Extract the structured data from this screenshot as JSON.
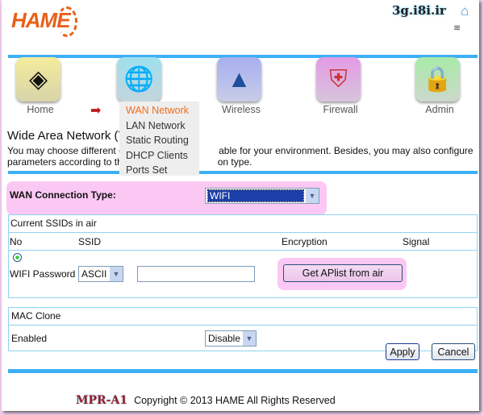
{
  "header": {
    "logo": "HAME",
    "site": "3g.i8i.ir",
    "home_icon": "home-icon",
    "signal_icon": "wifi-icon"
  },
  "nav": [
    {
      "label": "Home",
      "icon": "home-diamond-icon"
    },
    {
      "label": "",
      "icon": "globe-check-icon"
    },
    {
      "label": "Wireless",
      "icon": "antenna-icon"
    },
    {
      "label": "Firewall",
      "icon": "shield-icon"
    },
    {
      "label": "Admin",
      "icon": "lock-gear-icon"
    }
  ],
  "menu": [
    "WAN Network",
    "LAN Network",
    "Static Routing",
    "DHCP Clients",
    "Ports Set"
  ],
  "page": {
    "title": "Wide Area Network (T",
    "desc1": "You may choose different c",
    "desc1b": "able for your environment. Besides, you may also configure",
    "desc2": "parameters according to th",
    "desc2b": "on type."
  },
  "wan": {
    "label": "WAN Connection Type:",
    "value": "WIFI"
  },
  "ssid_table": {
    "title": "Current SSIDs in air",
    "columns": [
      "No",
      "SSID",
      "Encryption",
      "Signal"
    ],
    "password_label": "WIFI Password",
    "password_format": "ASCII",
    "password_value": "",
    "get_button": "Get APlist from air"
  },
  "mac": {
    "title": "MAC Clone",
    "enabled_label": "Enabled",
    "enabled_value": "Disable"
  },
  "buttons": {
    "apply": "Apply",
    "cancel": "Cancel"
  },
  "footer": {
    "model": "MPR-A1",
    "copyright": "Copyright © 2013 HAME All Rights Reserved"
  },
  "colors": {
    "accent": "#3cb0f6",
    "active_menu": "#f36d1e",
    "highlight": "#fbc8f4"
  }
}
